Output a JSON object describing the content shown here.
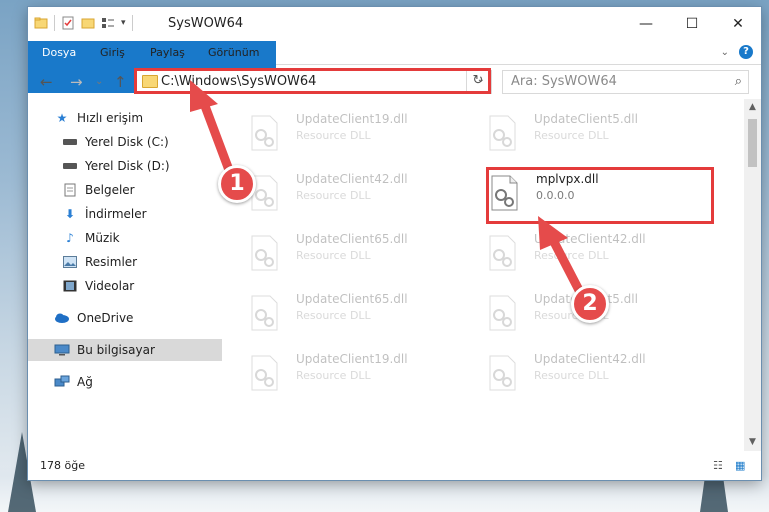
{
  "titlebar": {
    "title": "SysWOW64",
    "minimize": "—",
    "maximize": "☐",
    "close": "✕"
  },
  "ribbon": {
    "tabs": [
      "Dosya",
      "Giriş",
      "Paylaş",
      "Görünüm"
    ]
  },
  "navbar": {
    "back": "←",
    "forward": "→",
    "up": "↑",
    "address": "C:\\Windows\\SysWOW64",
    "search_placeholder": "Ara: SysWOW64"
  },
  "sidebar": {
    "items": [
      {
        "label": "Hızlı erişim",
        "icon": "star-icon"
      },
      {
        "label": "Yerel Disk (C:)",
        "icon": "drive-icon"
      },
      {
        "label": "Yerel Disk (D:)",
        "icon": "drive-icon"
      },
      {
        "label": "Belgeler",
        "icon": "documents-icon"
      },
      {
        "label": "İndirmeler",
        "icon": "download-icon"
      },
      {
        "label": "Müzik",
        "icon": "music-icon"
      },
      {
        "label": "Resimler",
        "icon": "pictures-icon"
      },
      {
        "label": "Videolar",
        "icon": "videos-icon"
      },
      {
        "label": "OneDrive",
        "icon": "cloud-icon"
      },
      {
        "label": "Bu bilgisayar",
        "icon": "computer-icon"
      },
      {
        "label": "Ağ",
        "icon": "network-icon"
      }
    ]
  },
  "files": [
    {
      "name": "UpdateClient19.dll",
      "desc": "Resource DLL"
    },
    {
      "name": "UpdateClient5.dll",
      "desc": "Resource DLL"
    },
    {
      "name": "UpdateClient42.dll",
      "desc": "Resource DLL"
    },
    {
      "name": "mplvpx.dll",
      "desc": "0.0.0.0"
    },
    {
      "name": "UpdateClient65.dll",
      "desc": "Resource DLL"
    },
    {
      "name": "UpdateClient42.dll",
      "desc": "Resource DLL"
    },
    {
      "name": "UpdateClient65.dll",
      "desc": "Resource DLL"
    },
    {
      "name": "UpdateClient5.dll",
      "desc": "Resource DLL"
    },
    {
      "name": "UpdateClient19.dll",
      "desc": "Resource DLL"
    },
    {
      "name": "UpdateClient42.dll",
      "desc": "Resource DLL"
    }
  ],
  "status": {
    "count": "178 öğe"
  },
  "annotations": {
    "badge1": "1",
    "badge2": "2"
  },
  "colors": {
    "accent": "#1979ca",
    "highlight": "#e43b3b"
  }
}
